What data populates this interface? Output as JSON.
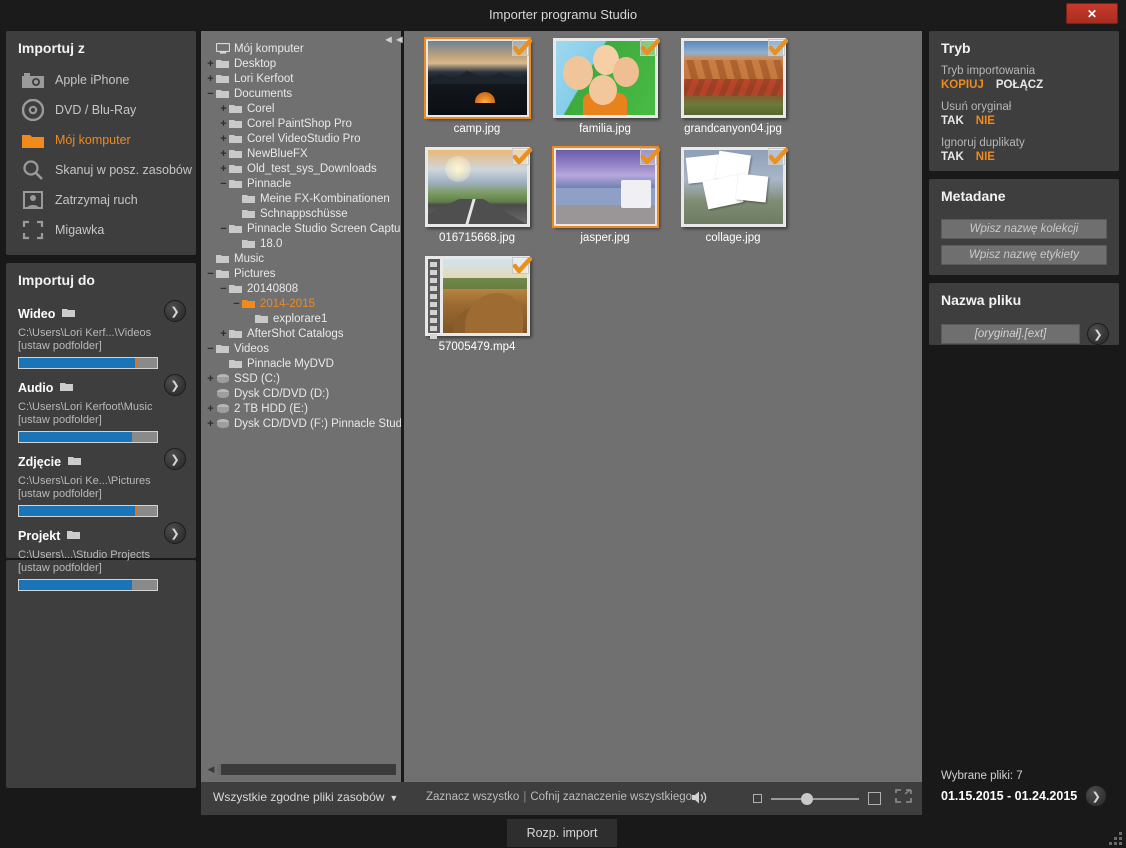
{
  "window": {
    "title": "Importer programu Studio",
    "close_label": "✕"
  },
  "import_from": {
    "title": "Importuj z",
    "items": [
      {
        "label": "Apple iPhone",
        "icon": "camera-icon",
        "active": false
      },
      {
        "label": "DVD / Blu-Ray",
        "icon": "disc-icon",
        "active": false
      },
      {
        "label": "Mój komputer",
        "icon": "folder-icon",
        "active": true
      },
      {
        "label": "Skanuj w posz. zasobów",
        "icon": "search-icon",
        "active": false
      },
      {
        "label": "Zatrzymaj ruch",
        "icon": "stopmotion-icon",
        "active": false
      },
      {
        "label": "Migawka",
        "icon": "snapshot-icon",
        "active": false
      }
    ]
  },
  "import_to": {
    "title": "Importuj do",
    "subfolder_label": "[ustaw podfolder]",
    "destinations": [
      {
        "label": "Wideo",
        "path": "C:\\Users\\Lori Kerf...\\Videos",
        "fill_pct": 86,
        "marker_pct": 86
      },
      {
        "label": "Audio",
        "path": "C:\\Users\\Lori Kerfoot\\Music",
        "fill_pct": 82,
        "marker_pct": -1
      },
      {
        "label": "Zdjęcie",
        "path": "C:\\Users\\Lori Ke...\\Pictures",
        "fill_pct": 86,
        "marker_pct": 86
      },
      {
        "label": "Projekt",
        "path": "C:\\Users\\...\\Studio Projects",
        "fill_pct": 82,
        "marker_pct": -1
      }
    ]
  },
  "tree": {
    "collapse_icon": "◄◄",
    "nodes": [
      {
        "label": "Mój komputer",
        "depth": 0,
        "toggle": "",
        "icon": "computer-icon",
        "selected": false
      },
      {
        "label": "Desktop",
        "depth": 0,
        "toggle": "+",
        "icon": "folder-icon",
        "selected": false
      },
      {
        "label": "Lori Kerfoot",
        "depth": 0,
        "toggle": "+",
        "icon": "folder-icon",
        "selected": false
      },
      {
        "label": "Documents",
        "depth": 0,
        "toggle": "−",
        "icon": "folder-icon",
        "selected": false
      },
      {
        "label": "Corel",
        "depth": 1,
        "toggle": "+",
        "icon": "folder-icon",
        "selected": false
      },
      {
        "label": "Corel PaintShop Pro",
        "depth": 1,
        "toggle": "+",
        "icon": "folder-icon",
        "selected": false
      },
      {
        "label": "Corel VideoStudio Pro",
        "depth": 1,
        "toggle": "+",
        "icon": "folder-icon",
        "selected": false
      },
      {
        "label": "NewBlueFX",
        "depth": 1,
        "toggle": "+",
        "icon": "folder-icon",
        "selected": false
      },
      {
        "label": "Old_test_sys_Downloads",
        "depth": 1,
        "toggle": "+",
        "icon": "folder-icon",
        "selected": false
      },
      {
        "label": "Pinnacle",
        "depth": 1,
        "toggle": "−",
        "icon": "folder-icon",
        "selected": false
      },
      {
        "label": "Meine FX-Kombinationen",
        "depth": 2,
        "toggle": "",
        "icon": "folder-icon",
        "selected": false
      },
      {
        "label": "Schnappschüsse",
        "depth": 2,
        "toggle": "",
        "icon": "folder-icon",
        "selected": false
      },
      {
        "label": "Pinnacle Studio Screen Capture",
        "depth": 1,
        "toggle": "−",
        "icon": "folder-icon",
        "selected": false
      },
      {
        "label": "18.0",
        "depth": 2,
        "toggle": "",
        "icon": "folder-icon",
        "selected": false
      },
      {
        "label": "Music",
        "depth": 0,
        "toggle": "",
        "icon": "folder-icon",
        "selected": false
      },
      {
        "label": "Pictures",
        "depth": 0,
        "toggle": "−",
        "icon": "folder-icon",
        "selected": false
      },
      {
        "label": "20140808",
        "depth": 1,
        "toggle": "−",
        "icon": "folder-icon",
        "selected": false
      },
      {
        "label": "2014-2015",
        "depth": 2,
        "toggle": "−",
        "icon": "folder-icon",
        "selected": true
      },
      {
        "label": "explorare1",
        "depth": 3,
        "toggle": "",
        "icon": "folder-icon",
        "selected": false
      },
      {
        "label": "AfterShot Catalogs",
        "depth": 1,
        "toggle": "+",
        "icon": "folder-icon",
        "selected": false
      },
      {
        "label": "Videos",
        "depth": 0,
        "toggle": "−",
        "icon": "folder-icon",
        "selected": false
      },
      {
        "label": "Pinnacle MyDVD",
        "depth": 1,
        "toggle": "",
        "icon": "folder-icon",
        "selected": false
      },
      {
        "label": "SSD (C:)",
        "depth": 0,
        "toggle": "+",
        "icon": "drive-icon",
        "selected": false
      },
      {
        "label": "Dysk CD/DVD (D:)",
        "depth": 0,
        "toggle": "",
        "icon": "drive-icon",
        "selected": false
      },
      {
        "label": "2 TB HDD (E:)",
        "depth": 0,
        "toggle": "+",
        "icon": "drive-icon",
        "selected": false
      },
      {
        "label": "Dysk CD/DVD (F:) Pinnacle Studio",
        "depth": 0,
        "toggle": "+",
        "icon": "drive-icon",
        "selected": false
      }
    ]
  },
  "thumbnails": [
    {
      "name": "camp.jpg",
      "art": "im-camp",
      "checked": true,
      "selected": true,
      "video": false
    },
    {
      "name": "familia.jpg",
      "art": "im-familia",
      "checked": true,
      "selected": false,
      "video": false
    },
    {
      "name": "grandcanyon04.jpg",
      "art": "im-canyon",
      "checked": true,
      "selected": false,
      "video": false
    },
    {
      "name": "016715668.jpg",
      "art": "im-road",
      "checked": true,
      "selected": false,
      "video": false
    },
    {
      "name": "jasper.jpg",
      "art": "im-jasper",
      "checked": true,
      "selected": true,
      "video": false
    },
    {
      "name": "collage.jpg",
      "art": "im-collage",
      "checked": true,
      "selected": false,
      "video": false
    },
    {
      "name": "57005479.mp4",
      "art": "im-video",
      "checked": true,
      "selected": false,
      "video": true
    }
  ],
  "midbar": {
    "filter_label": "Wszystkie zgodne pliki zasobów",
    "caret": "▼",
    "select_all": "Zaznacz wszystko",
    "separator": "|",
    "deselect_all": "Cofnij zaznaczenie wszystkiego",
    "speaker_icon": "speaker-icon",
    "fullscreen_icon": "fullscreen-icon",
    "zoom_value": 34
  },
  "mode": {
    "title": "Tryb",
    "import_mode_label": "Tryb importowania",
    "import_mode_options": [
      {
        "label": "KOPIUJ",
        "on": true
      },
      {
        "label": "POŁĄCZ",
        "on": false
      }
    ],
    "delete_original_label": "Usuń oryginał",
    "delete_original_options": [
      {
        "label": "TAK",
        "on": false
      },
      {
        "label": "NIE",
        "on": true
      }
    ],
    "ignore_dupes_label": "Ignoruj duplikaty",
    "ignore_dupes_options": [
      {
        "label": "TAK",
        "on": false
      },
      {
        "label": "NIE",
        "on": true
      }
    ]
  },
  "metadata": {
    "title": "Metadane",
    "collection_placeholder": "Wpisz nazwę kolekcji",
    "tag_placeholder": "Wpisz nazwę etykiety"
  },
  "filename": {
    "title": "Nazwa pliku",
    "pattern_placeholder": "[oryginał].[ext]"
  },
  "summary": {
    "selected_files": "Wybrane pliki: 7",
    "date_range": "01.15.2015 - 01.24.2015"
  },
  "footer": {
    "start_label": "Rozp. import"
  },
  "colors": {
    "accent_orange": "#f08a1c",
    "panel_dark": "#3e3e3e",
    "panel_gray": "#707070",
    "progress_blue": "#1a75b8",
    "close_red": "#c9392b"
  }
}
